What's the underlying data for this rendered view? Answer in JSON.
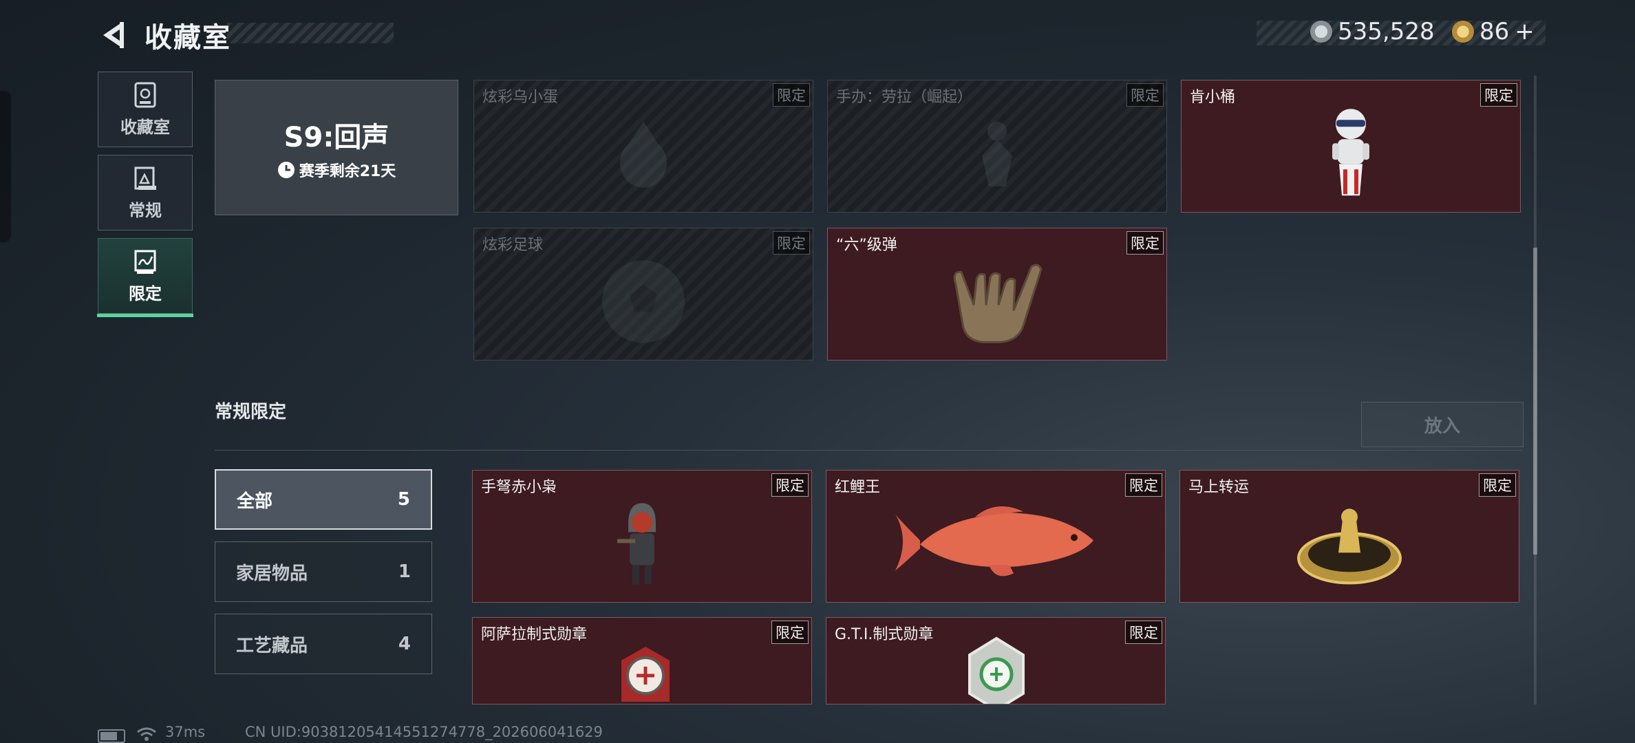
{
  "header": {
    "title": "收藏室",
    "currency_1": "535,528",
    "currency_2": "86",
    "add_label": "+",
    "colors": {
      "accent": "#5fd1a1",
      "card_bg": "#3d1b21"
    }
  },
  "nav": {
    "items": [
      {
        "label": "收藏室",
        "icon": "trophy-icon"
      },
      {
        "label": "常规",
        "icon": "frame-icon"
      },
      {
        "label": "限定",
        "icon": "limited-icon",
        "active": true
      }
    ]
  },
  "season": {
    "title": "S9:回声",
    "remaining": "赛季剩余21天"
  },
  "season_items": [
    {
      "name": "炫彩乌小蛋",
      "badge": "限定",
      "owned": false,
      "icon": "bird-figurine-icon"
    },
    {
      "name": "手办：劳拉（崛起）",
      "badge": "限定",
      "owned": false,
      "icon": "figure-icon"
    },
    {
      "name": "肯小桶",
      "badge": "限定",
      "owned": true,
      "icon": "bucket-robot-icon"
    },
    {
      "name": "炫彩足球",
      "badge": "限定",
      "owned": false,
      "icon": "soccer-ball-icon"
    },
    {
      "name": "“六”级弹",
      "badge": "限定",
      "owned": true,
      "icon": "hand-sign-icon"
    }
  ],
  "regular_section": {
    "title": "常规限定",
    "put_button": "放入",
    "filters": [
      {
        "label": "全部",
        "count": "5",
        "active": true
      },
      {
        "label": "家居物品",
        "count": "1"
      },
      {
        "label": "工艺藏品",
        "count": "4"
      }
    ],
    "items": [
      {
        "name": "手弩赤小枭",
        "badge": "限定",
        "icon": "hooded-figure-icon"
      },
      {
        "name": "红鲤王",
        "badge": "限定",
        "icon": "carp-fish-icon"
      },
      {
        "name": "马上转运",
        "badge": "限定",
        "icon": "gold-disc-icon"
      },
      {
        "name": "阿萨拉制式勋章",
        "badge": "限定",
        "icon": "medal-icon"
      },
      {
        "name": "G.T.I.制式勋章",
        "badge": "限定",
        "icon": "medal-icon"
      }
    ]
  },
  "footer": {
    "ping": "37ms",
    "uid": "CN UID:903812054145512747​78_202606041629"
  }
}
